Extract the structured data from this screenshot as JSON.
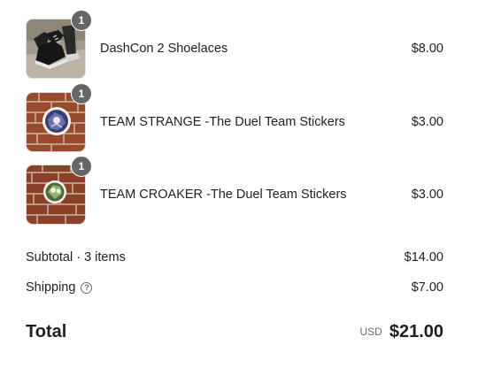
{
  "line_items": [
    {
      "quantity": "1",
      "title": "DashCon 2 Shoelaces",
      "price": "$8.00",
      "thumbnail": "shoe-photo"
    },
    {
      "quantity": "1",
      "title": "TEAM STRANGE -The Duel Team Stickers",
      "price": "$3.00",
      "thumbnail": "sticker-on-brick-photo"
    },
    {
      "quantity": "1",
      "title": "TEAM CROAKER -The Duel Team Stickers",
      "price": "$3.00",
      "thumbnail": "sticker-on-brick-photo"
    }
  ],
  "summary": {
    "subtotal_label": "Subtotal · 3 items",
    "subtotal_value": "$14.00",
    "shipping_label": "Shipping",
    "shipping_help_icon": "question-circle-icon",
    "shipping_value": "$7.00"
  },
  "total": {
    "label": "Total",
    "currency": "USD",
    "amount": "$21.00"
  },
  "colors": {
    "badge": "#666666",
    "text": "#1f1f1f",
    "muted": "#6b6b6b",
    "brick": "#9a4a2c"
  }
}
